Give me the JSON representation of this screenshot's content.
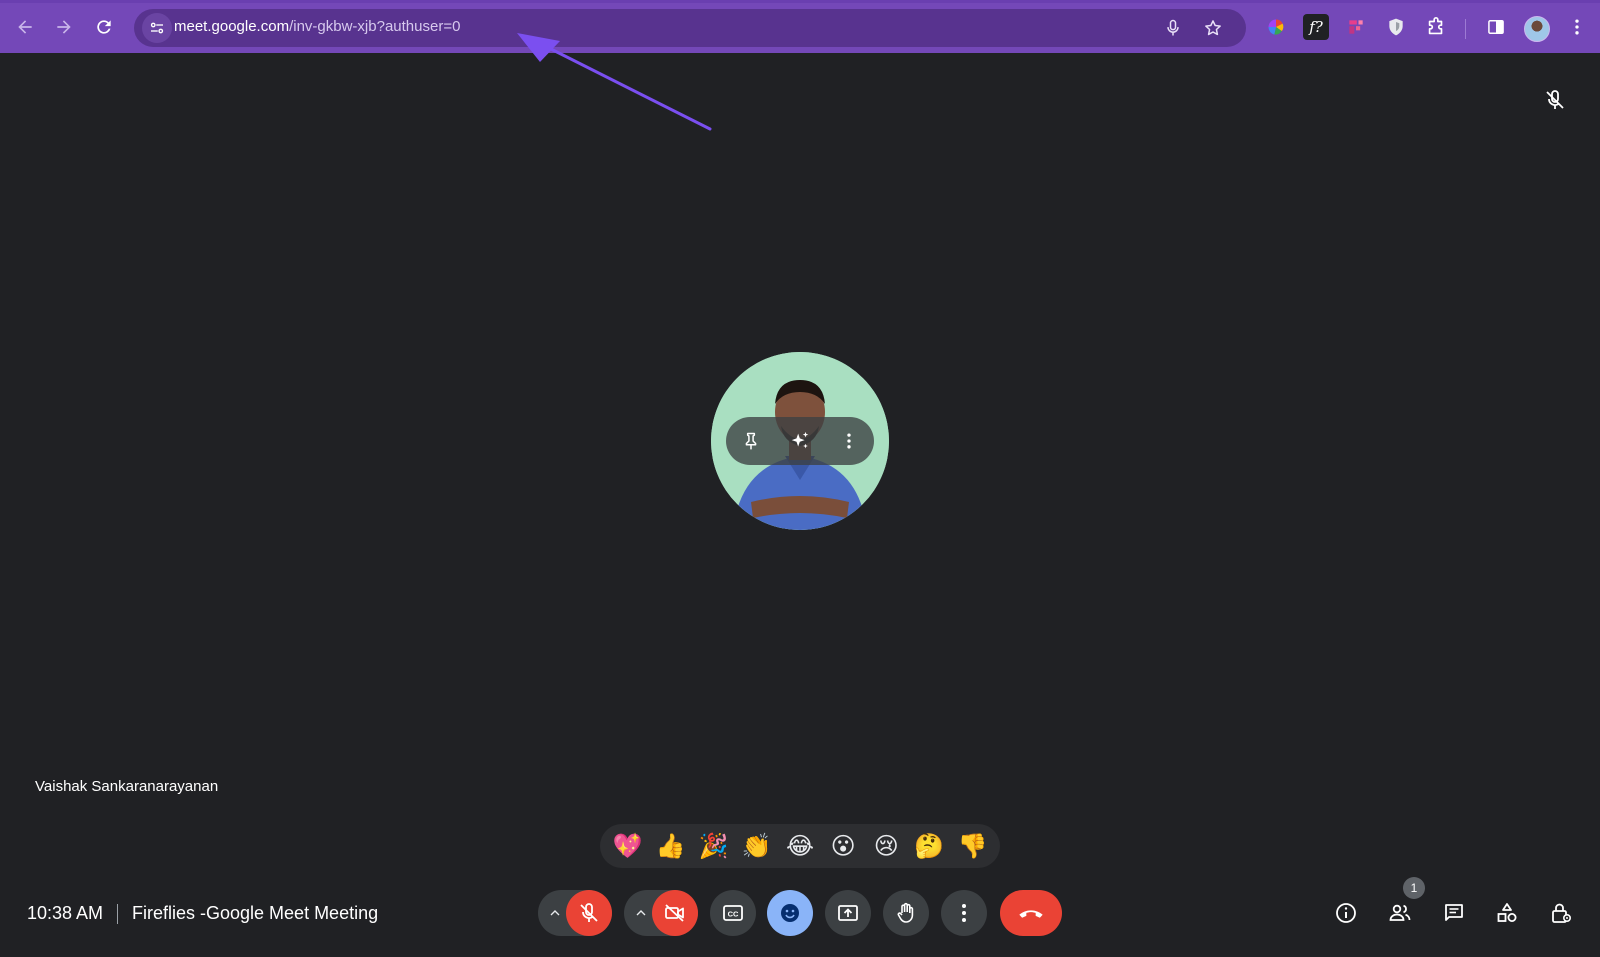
{
  "browser": {
    "url_host": "meet.google.com",
    "url_path": "/inv-gkbw-xjb?authuser=0",
    "toolbar_color": "#7448b8",
    "icons": [
      "back-icon",
      "forward-icon",
      "reload-icon",
      "site-info-icon",
      "voice-search-icon",
      "bookmark-star-icon",
      "color-picker-extension-icon",
      "fonts-extension-icon",
      "fireflies-extension-icon",
      "shield-extension-icon",
      "extensions-puzzle-icon",
      "side-panel-icon",
      "profile-avatar",
      "chrome-menu-icon"
    ]
  },
  "annotation": {
    "arrow_color": "#7b4ff0"
  },
  "stage": {
    "background": "#202124",
    "participant_name": "Vaishak Sankaranarayanan",
    "tile_actions": [
      "pin-icon",
      "visual-effects-sparkle-icon",
      "more-options-icon"
    ]
  },
  "reactions": [
    "💖",
    "👍",
    "🎉",
    "👏",
    "😂",
    "😮",
    "😢",
    "🤔",
    "👎"
  ],
  "bottom_bar": {
    "time": "10:38 AM",
    "meeting_title": "Fireflies -Google Meet Meeting",
    "participant_count": "1",
    "accent_red": "#ea4335",
    "accent_blue": "#8ab4f8"
  }
}
